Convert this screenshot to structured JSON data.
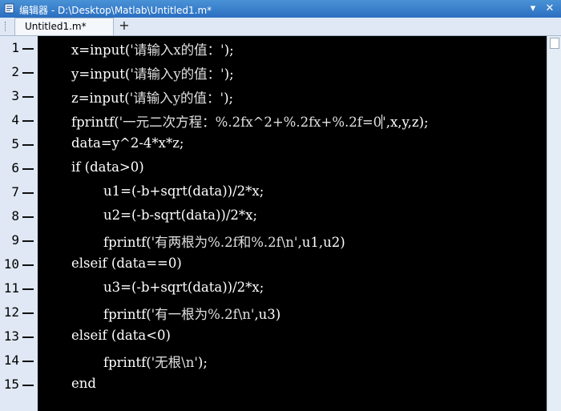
{
  "window": {
    "title": "编辑器 - D:\\Desktop\\Matlab\\Untitled1.m*"
  },
  "tabs": [
    {
      "label": "Untitled1.m*"
    }
  ],
  "add_tab_label": "+",
  "title_buttons": {
    "menu": "▾",
    "close": "✕"
  },
  "lines": [
    {
      "num": "1",
      "indent": 0,
      "parts": [
        {
          "t": "x=input(",
          "c": "code"
        },
        {
          "t": "'请输入x的值：'",
          "c": "str"
        },
        {
          "t": ");",
          "c": "code"
        }
      ]
    },
    {
      "num": "2",
      "indent": 0,
      "parts": [
        {
          "t": "y=input(",
          "c": "code"
        },
        {
          "t": "'请输入y的值：'",
          "c": "str"
        },
        {
          "t": ");",
          "c": "code"
        }
      ]
    },
    {
      "num": "3",
      "indent": 0,
      "parts": [
        {
          "t": "z=input(",
          "c": "code"
        },
        {
          "t": "'请输入y的值：'",
          "c": "str"
        },
        {
          "t": ");",
          "c": "code"
        }
      ]
    },
    {
      "num": "4",
      "indent": 0,
      "parts": [
        {
          "t": "fprintf(",
          "c": "code"
        },
        {
          "t": "'一元二次方程：%.2fx^2+%.2fx+%.2f=0",
          "c": "str"
        },
        {
          "t": "|",
          "c": "caret"
        },
        {
          "t": "'",
          "c": "str"
        },
        {
          "t": ",x,y,z);",
          "c": "code"
        }
      ]
    },
    {
      "num": "5",
      "indent": 0,
      "parts": [
        {
          "t": "data=y^2-4*x*z;",
          "c": "code"
        }
      ]
    },
    {
      "num": "6",
      "indent": 0,
      "parts": [
        {
          "t": "if (data>0)",
          "c": "code"
        }
      ]
    },
    {
      "num": "7",
      "indent": 1,
      "parts": [
        {
          "t": "u1=(-b+sqrt(data))/2*x;",
          "c": "code"
        }
      ]
    },
    {
      "num": "8",
      "indent": 1,
      "parts": [
        {
          "t": "u2=(-b-sqrt(data))/2*x;",
          "c": "code"
        }
      ]
    },
    {
      "num": "9",
      "indent": 1,
      "parts": [
        {
          "t": "fprintf(",
          "c": "code"
        },
        {
          "t": "'有两根为%.2f和%.2f\\n'",
          "c": "str"
        },
        {
          "t": ",u1,u2)",
          "c": "code"
        }
      ]
    },
    {
      "num": "10",
      "indent": 0,
      "parts": [
        {
          "t": "elseif (data==0)",
          "c": "code"
        }
      ]
    },
    {
      "num": "11",
      "indent": 1,
      "parts": [
        {
          "t": "u3=(-b+sqrt(data))/2*x;",
          "c": "code"
        }
      ]
    },
    {
      "num": "12",
      "indent": 1,
      "parts": [
        {
          "t": "fprintf(",
          "c": "code"
        },
        {
          "t": "'有一根为%.2f\\n'",
          "c": "str"
        },
        {
          "t": ",u3)",
          "c": "code"
        }
      ]
    },
    {
      "num": "13",
      "indent": 0,
      "parts": [
        {
          "t": "elseif (data<0)",
          "c": "code"
        }
      ]
    },
    {
      "num": "14",
      "indent": 1,
      "parts": [
        {
          "t": "fprintf(",
          "c": "code"
        },
        {
          "t": "'无根\\n'",
          "c": "str"
        },
        {
          "t": ");",
          "c": "code"
        }
      ]
    },
    {
      "num": "15",
      "indent": 0,
      "parts": [
        {
          "t": "end",
          "c": "code"
        }
      ]
    }
  ]
}
